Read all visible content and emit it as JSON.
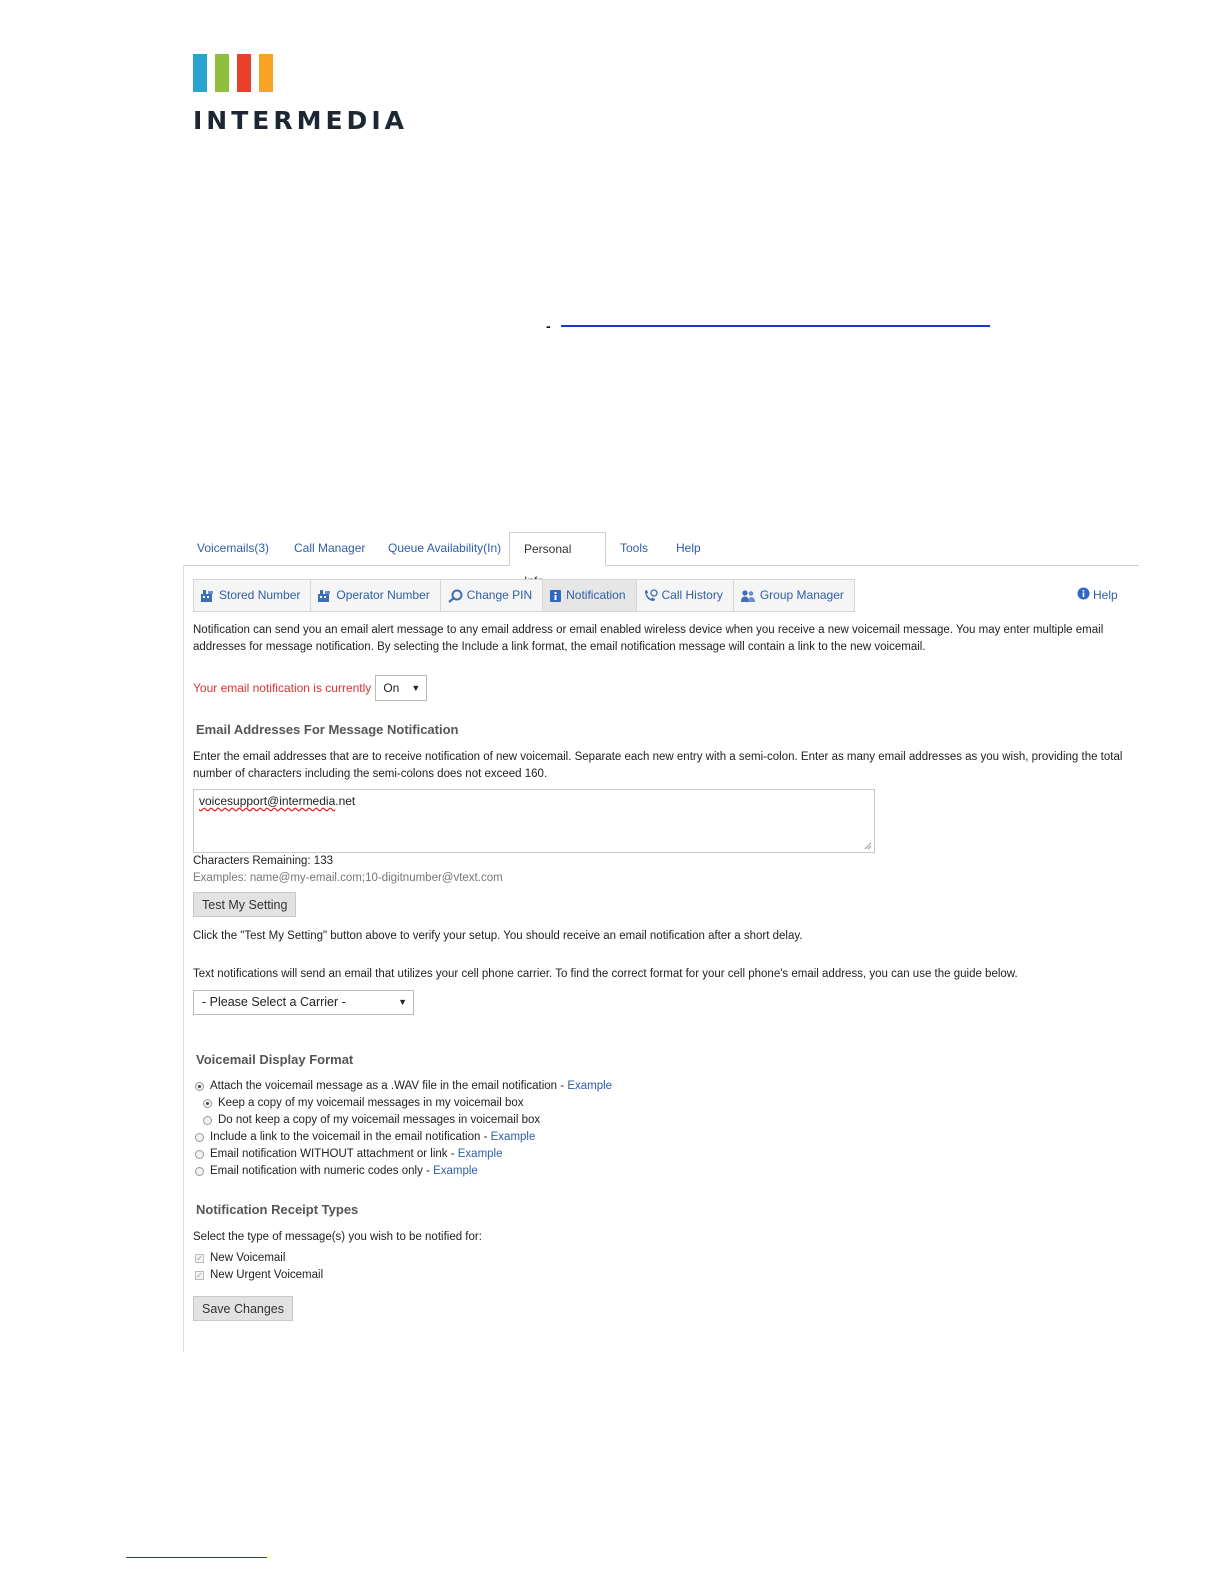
{
  "brand": {
    "name": "INTERMEDIA",
    "bar_colors": [
      "#2aa3cf",
      "#8dbf3a",
      "#e8412c",
      "#f6a421"
    ]
  },
  "doc": {
    "dash": "-"
  },
  "main_tabs": [
    {
      "label": "Voicemails(3)"
    },
    {
      "label": "Call Manager"
    },
    {
      "label": "Queue Availability(In)"
    },
    {
      "label": "Personal Info"
    },
    {
      "label": "Tools"
    },
    {
      "label": "Help"
    }
  ],
  "sub_tabs": [
    {
      "label": "Stored Number",
      "icon": "stored-number-icon"
    },
    {
      "label": "Operator Number",
      "icon": "operator-number-icon"
    },
    {
      "label": "Change PIN",
      "icon": "change-pin-icon"
    },
    {
      "label": "Notification",
      "icon": "notification-icon"
    },
    {
      "label": "Call History",
      "icon": "call-history-icon"
    },
    {
      "label": "Group Manager",
      "icon": "group-manager-icon"
    }
  ],
  "help_label": "Help",
  "intro": {
    "line1": "Notification can send you an email alert message to any email address or email enabled wireless device when you receive a new voicemail message. You may enter multiple email",
    "line2": "addresses for message notification. By selecting the Include a link format, the email notification message will contain a link to the new voicemail."
  },
  "status": {
    "label": "Your email notification is currently",
    "value": "On"
  },
  "email_section": {
    "title": "Email Addresses For Message Notification",
    "desc1": "Enter the email addresses that are to receive notification of new voicemail. Separate each new entry with a semi-colon. Enter as many email addresses as you wish, providing the total",
    "desc2": "number of characters including the semi-colons does not exceed 160.",
    "value_user": "voicesupport@intermedia",
    "value_tld": ".net",
    "chars_remaining": "Characters Remaining: 133",
    "examples": "Examples: name@my-email.com;10-digitnumber@vtext.com",
    "test_button": "Test My Setting",
    "test_hint": "Click the \"Test My Setting\" button above to verify your setup. You should receive an email notification after a short delay.",
    "carrier_hint": "Text notifications will send an email that utilizes your cell phone carrier. To find the correct format for your cell phone's email address, you can use the guide below.",
    "carrier_placeholder": "- Please Select a Carrier -"
  },
  "display_format": {
    "title": "Voicemail Display Format",
    "options": [
      {
        "label": "Attach the voicemail message as a .WAV file in the email notification - ",
        "link": "Example",
        "checked": true
      },
      {
        "label": "Keep a copy of my voicemail messages in my voicemail box",
        "checked": true
      },
      {
        "label": "Do not keep a copy of my voicemail messages in voicemail box",
        "checked": false
      },
      {
        "label": "Include a link to the voicemail in the email notification - ",
        "link": "Example",
        "checked": false
      },
      {
        "label": "Email notification WITHOUT attachment or link - ",
        "link": "Example",
        "checked": false
      },
      {
        "label": "Email notification with numeric codes only - ",
        "link": "Example",
        "checked": false
      }
    ]
  },
  "receipt_types": {
    "title": "Notification Receipt Types",
    "desc": "Select the type of message(s) you wish to be notified for:",
    "options": [
      {
        "label": "New Voicemail",
        "checked": true
      },
      {
        "label": "New Urgent Voicemail",
        "checked": true
      }
    ]
  },
  "save_button": "Save Changes"
}
